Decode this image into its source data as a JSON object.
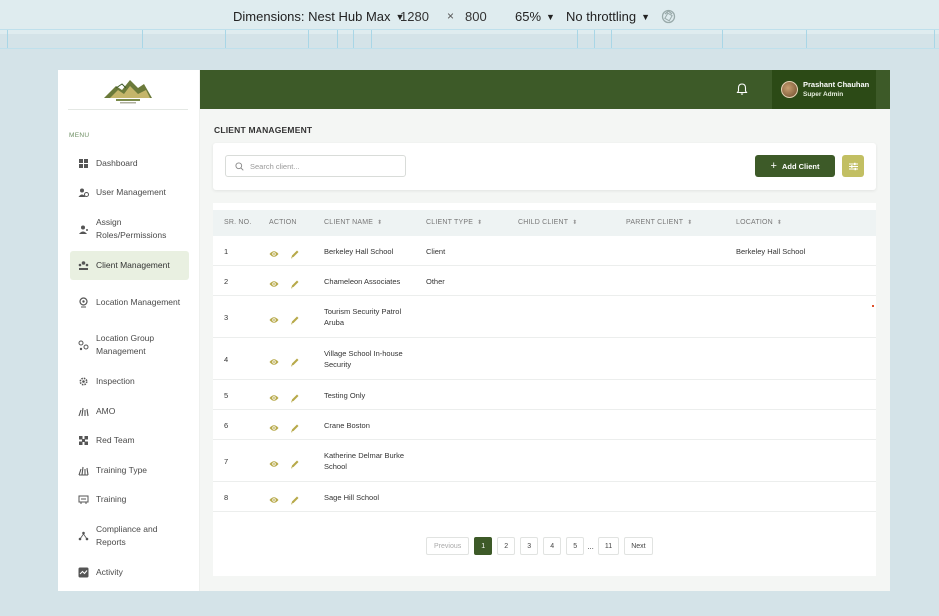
{
  "devtools": {
    "dimensions_label": "Dimensions: Nest Hub Max",
    "width": "1280",
    "times": "×",
    "height": "800",
    "zoom": "65%",
    "throttling": "No throttling"
  },
  "sidebar": {
    "menu_label": "MENU",
    "items": [
      {
        "label": "Dashboard",
        "icon": "grid-icon"
      },
      {
        "label": "User Management",
        "icon": "users-icon"
      },
      {
        "label": "Assign Roles/Permissions",
        "icon": "user-key-icon"
      },
      {
        "label": "Client Management",
        "icon": "client-group-icon",
        "active": true
      },
      {
        "label": "Location Management",
        "icon": "location-pin-icon"
      },
      {
        "label": "Location Group Management",
        "icon": "location-group-icon"
      },
      {
        "label": "Inspection",
        "icon": "gear-icon"
      },
      {
        "label": "AMO",
        "icon": "amo-icon"
      },
      {
        "label": "Red Team",
        "icon": "team-icon"
      },
      {
        "label": "Training Type",
        "icon": "training-type-icon"
      },
      {
        "label": "Training",
        "icon": "training-icon"
      },
      {
        "label": "Compliance and Reports",
        "icon": "compliance-icon"
      },
      {
        "label": "Activity",
        "icon": "activity-icon"
      }
    ]
  },
  "header": {
    "user_name": "Prashant Chauhan",
    "user_role": "Super Admin"
  },
  "main": {
    "title": "CLIENT MANAGEMENT",
    "search_placeholder": "Search client...",
    "add_button": "Add Client",
    "columns": [
      "SR. NO.",
      "ACTION",
      "CLIENT NAME",
      "CLIENT TYPE",
      "CHILD CLIENT",
      "PARENT CLIENT",
      "LOCATION"
    ],
    "rows": [
      {
        "sr": "1",
        "name": "Berkeley Hall School",
        "type": "Client",
        "child": "",
        "parent": "",
        "location": "Berkeley Hall School"
      },
      {
        "sr": "2",
        "name": "Chameleon Associates",
        "type": "Other",
        "child": "",
        "parent": "",
        "location": ""
      },
      {
        "sr": "3",
        "name": "Tourism Security Patrol Aruba",
        "type": "",
        "child": "",
        "parent": "",
        "location": ""
      },
      {
        "sr": "4",
        "name": "Village School In-house Security",
        "type": "",
        "child": "",
        "parent": "",
        "location": ""
      },
      {
        "sr": "5",
        "name": "Testing Only",
        "type": "",
        "child": "",
        "parent": "",
        "location": ""
      },
      {
        "sr": "6",
        "name": "Crane Boston",
        "type": "",
        "child": "",
        "parent": "",
        "location": ""
      },
      {
        "sr": "7",
        "name": "Katherine Delmar Burke School",
        "type": "",
        "child": "",
        "parent": "",
        "location": ""
      },
      {
        "sr": "8",
        "name": "Sage Hill School",
        "type": "",
        "child": "",
        "parent": "",
        "location": ""
      }
    ],
    "pagination": {
      "previous": "Previous",
      "pages": [
        "1",
        "2",
        "3",
        "4",
        "5"
      ],
      "ellipsis": "...",
      "last": "11",
      "next": "Next",
      "current": "1"
    }
  },
  "colors": {
    "brand_green": "#3d5a28",
    "user_box": "#2c4a16",
    "accent_olive": "#c2bf63",
    "icon_olive": "#b7a94a"
  }
}
